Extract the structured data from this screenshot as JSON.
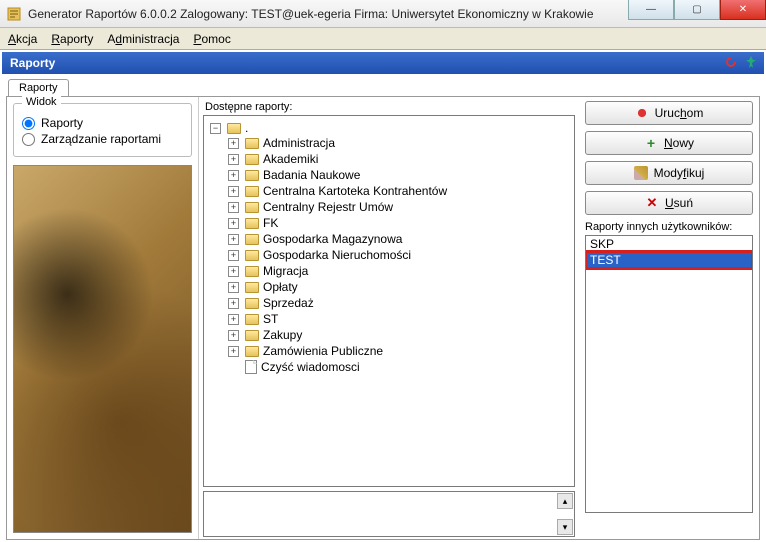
{
  "window": {
    "title": "Generator Raportów 6.0.0.2   Zalogowany: TEST@uek-egeria  Firma: Uniwersytet Ekonomiczny w Krakowie"
  },
  "menu": {
    "items": [
      "Akcja",
      "Raporty",
      "Administracja",
      "Pomoc"
    ]
  },
  "section": {
    "title": "Raporty"
  },
  "tabs": {
    "active": "Raporty"
  },
  "view_group": {
    "legend": "Widok",
    "option_reports": "Raporty",
    "option_manage": "Zarządzanie raportami",
    "selected": "reports"
  },
  "tree": {
    "label": "Dostępne raporty:",
    "root_expanded": true,
    "folders": [
      "Administracja",
      "Akademiki",
      "Badania Naukowe",
      "Centralna Kartoteka Kontrahentów",
      "Centralny Rejestr Umów",
      "FK",
      "Gospodarka Magazynowa",
      "Gospodarka Nieruchomości",
      "Migracja",
      "Opłaty",
      "Sprzedaż",
      "ST",
      "Zakupy",
      "Zamówienia Publiczne"
    ],
    "leaf": "Czyść wiadomosci"
  },
  "buttons": {
    "run": "Uruchom",
    "new": "Nowy",
    "modify": "Modyfikuj",
    "delete": "Usuń"
  },
  "right": {
    "label": "Raporty innych użytkowników:",
    "items": [
      "SKP",
      "TEST"
    ],
    "selected_index": 1
  }
}
